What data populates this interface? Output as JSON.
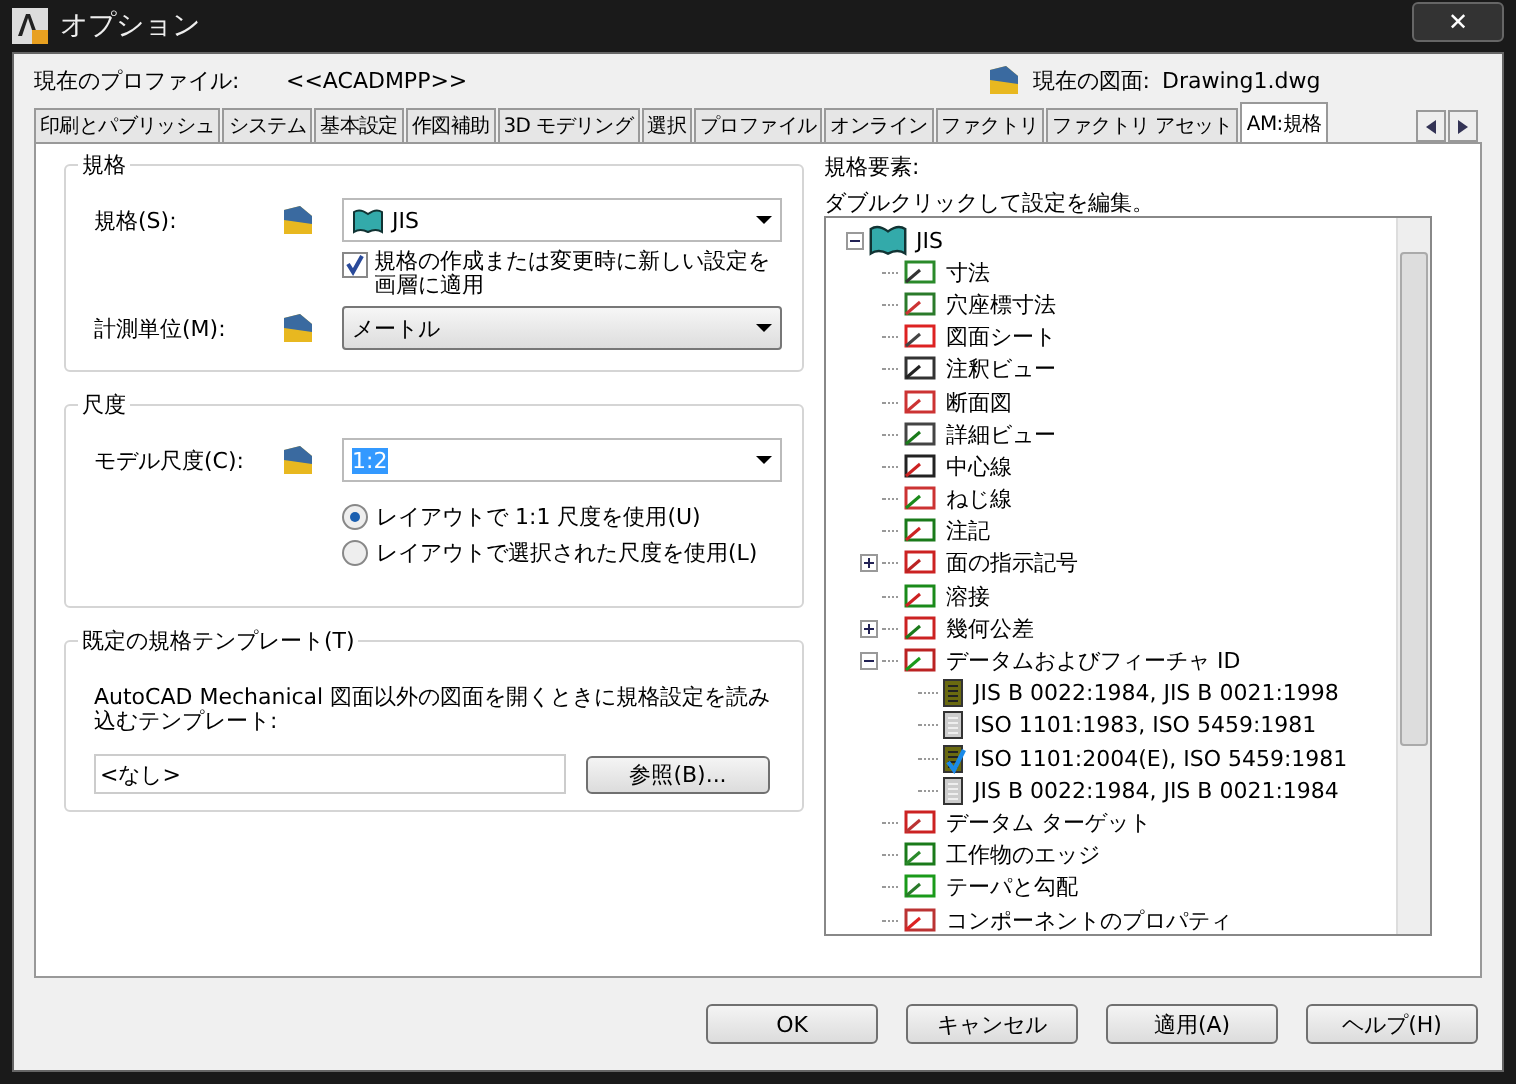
{
  "window": {
    "title": "オプション",
    "close": "✕"
  },
  "profile": {
    "label": "現在のプロファイル:",
    "value": "<<ACADMPP>>",
    "drawing_label": "現在の図面:",
    "drawing_value": "Drawing1.dwg"
  },
  "tabs": [
    {
      "label": "印刷とパブリッシュ",
      "selected": false
    },
    {
      "label": "システム",
      "selected": false
    },
    {
      "label": "基本設定",
      "selected": false
    },
    {
      "label": "作図補助",
      "selected": false
    },
    {
      "label": "3D モデリング",
      "selected": false
    },
    {
      "label": "選択",
      "selected": false
    },
    {
      "label": "プロファイル",
      "selected": false
    },
    {
      "label": "オンライン",
      "selected": false
    },
    {
      "label": "ファクトリ",
      "selected": false
    },
    {
      "label": "ファクトリ アセット",
      "selected": false
    },
    {
      "label": "AM:規格",
      "selected": true
    }
  ],
  "standard_group": {
    "title": "規格",
    "standard_label": "規格(S):",
    "standard_value": "JIS",
    "apply_checkbox": {
      "label": "規格の作成または変更時に新しい設定を画層に適用",
      "checked": true
    },
    "unit_label": "計測単位(M):",
    "unit_value": "メートル"
  },
  "scale_group": {
    "title": "尺度",
    "model_scale_label": "モデル尺度(C):",
    "model_scale_value": "1:2",
    "radios": [
      {
        "label": "レイアウトで 1:1 尺度を使用(U)",
        "selected": true
      },
      {
        "label": "レイアウトで選択された尺度を使用(L)",
        "selected": false
      }
    ]
  },
  "template_group": {
    "title": "既定の規格テンプレート(T)",
    "description": "AutoCAD Mechanical 図面以外の図面を開くときに規格設定を読み込むテンプレート:",
    "value": "<なし>",
    "browse_button": "参照(B)..."
  },
  "elements": {
    "title": "規格要素:",
    "hint": "ダブルクリックして設定を編集。",
    "tree": [
      {
        "label": "JIS",
        "expanded": true,
        "children": [
          {
            "label": "寸法"
          },
          {
            "label": "穴座標寸法"
          },
          {
            "label": "図面シート"
          },
          {
            "label": "注釈ビュー"
          },
          {
            "label": "断面図"
          },
          {
            "label": "詳細ビュー"
          },
          {
            "label": "中心線"
          },
          {
            "label": "ねじ線"
          },
          {
            "label": "注記"
          },
          {
            "label": "面の指示記号",
            "expanded": false
          },
          {
            "label": "溶接"
          },
          {
            "label": "幾何公差",
            "expanded": false
          },
          {
            "label": "データムおよびフィーチャ ID",
            "expanded": true,
            "children": [
              {
                "label": "JIS B 0022:1984, JIS B 0021:1998",
                "available": true,
                "checked": false
              },
              {
                "label": "ISO 1101:1983, ISO 5459:1981",
                "available": false,
                "checked": false
              },
              {
                "label": "ISO 1101:2004(E), ISO 5459:1981",
                "available": true,
                "checked": true
              },
              {
                "label": "JIS B 0022:1984, JIS B 0021:1984",
                "available": false,
                "checked": false
              }
            ]
          },
          {
            "label": "データム ターゲット"
          },
          {
            "label": "工作物のエッジ"
          },
          {
            "label": "テーパと勾配"
          },
          {
            "label": "コンポーネントのプロパティ"
          }
        ]
      }
    ]
  },
  "buttons": [
    "OK",
    "キャンセル",
    "適用(A)",
    "ヘルプ(H)"
  ]
}
